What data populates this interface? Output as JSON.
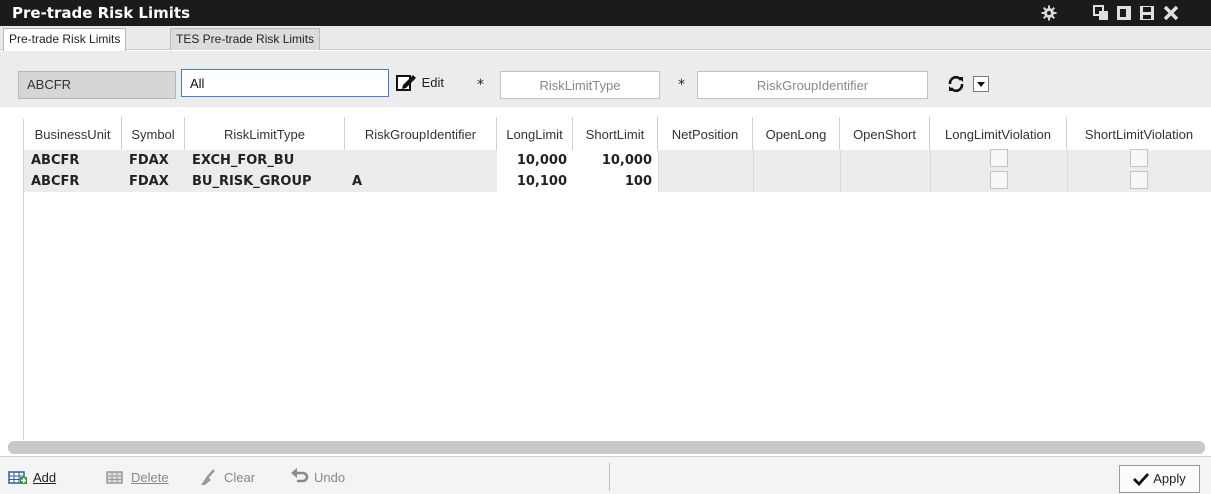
{
  "window": {
    "title": "Pre-trade Risk Limits"
  },
  "tabs": [
    {
      "label": "Pre-trade Risk Limits",
      "active": true
    },
    {
      "label": "TES Pre-trade Risk Limits",
      "active": false
    }
  ],
  "filters": {
    "business_unit": "ABCFR",
    "symbol_value": "All",
    "edit_label": "Edit",
    "required_marker": "*",
    "risk_limit_type_placeholder": "RiskLimitType",
    "risk_group_placeholder": "RiskGroupIdentifier"
  },
  "table": {
    "columns": [
      "BusinessUnit",
      "Symbol",
      "RiskLimitType",
      "RiskGroupIdentifier",
      "LongLimit",
      "ShortLimit",
      "NetPosition",
      "OpenLong",
      "OpenShort",
      "LongLimitViolation",
      "ShortLimitViolation"
    ],
    "rows": [
      {
        "business_unit": "ABCFR",
        "symbol": "FDAX",
        "risk_limit_type": "EXCH_FOR_BU",
        "risk_group": "",
        "long_limit": "10,000",
        "short_limit": "10,000",
        "long_violation": false,
        "short_violation": false
      },
      {
        "business_unit": "ABCFR",
        "symbol": "FDAX",
        "risk_limit_type": "BU_RISK_GROUP",
        "risk_group": "A",
        "long_limit": "10,100",
        "short_limit": "100",
        "long_violation": false,
        "short_violation": false
      }
    ]
  },
  "toolbar": {
    "add_label": "Add",
    "delete_label": "Delete",
    "clear_label": "Clear",
    "undo_label": "Undo",
    "apply_label": "Apply"
  },
  "colors": {
    "titlebar_bg": "#1b1b1b",
    "input_focus_border": "#3d7ed6",
    "row_bg": "#ececec"
  },
  "icons": [
    "gear-icon",
    "restore-icon",
    "detach-icon",
    "save-icon",
    "close-icon",
    "edit-icon",
    "refresh-icon",
    "dropdown-icon",
    "add-row-icon",
    "delete-row-icon",
    "clear-icon",
    "undo-icon",
    "checkmark-icon"
  ]
}
